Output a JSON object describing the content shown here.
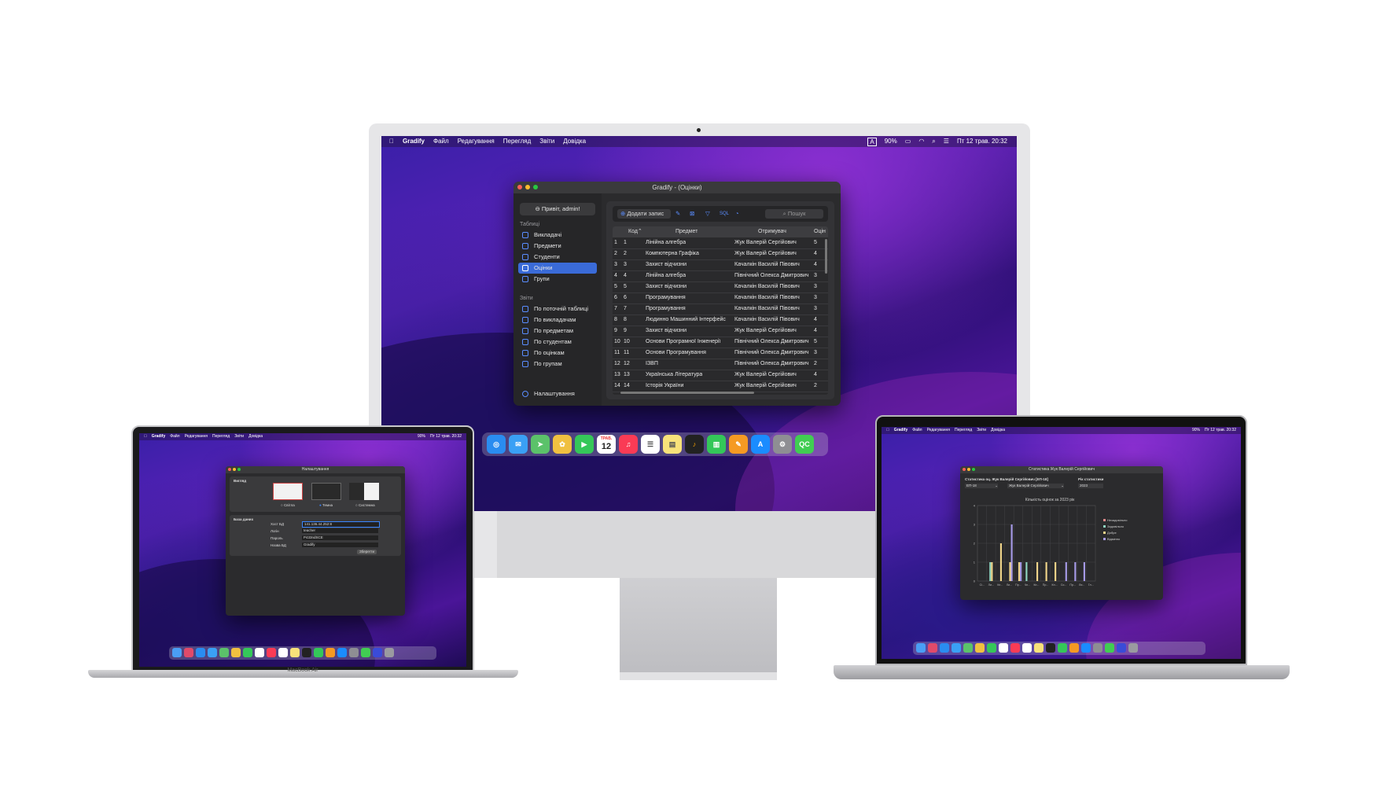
{
  "imac": {
    "menubar": {
      "app": "Gradify",
      "items": [
        "Файл",
        "Редагування",
        "Перегляд",
        "Звіти",
        "Довідка"
      ],
      "battery": "90%",
      "datetime": "Пт 12 трав. 20:32",
      "input": "A"
    },
    "window": {
      "title": "Gradify - (Оцінки)",
      "greeting": "Привіт, admin!",
      "tables_header": "Таблиці",
      "tables": [
        "Викладачі",
        "Предмети",
        "Студенти",
        "Оцінки",
        "Групи"
      ],
      "reports_header": "Звіти",
      "reports": [
        "По поточній таблиці",
        "По викладачам",
        "По предметам",
        "По студентам",
        "По оцінкам",
        "По групам"
      ],
      "settings": "Налаштування",
      "add_button": "Додати запис",
      "search_placeholder": "Пошук",
      "sql_label": "SQL",
      "columns": [
        "Код",
        "Предмет",
        "Отримувач",
        "Оцін"
      ],
      "rows": [
        {
          "n": "1",
          "id": "1",
          "subject": "Лінійна алгебра",
          "student": "Жук Валерій Сергійович",
          "grade": "5"
        },
        {
          "n": "2",
          "id": "2",
          "subject": "Компютерна Графіка",
          "student": "Жук Валерій Сергійович",
          "grade": "4"
        },
        {
          "n": "3",
          "id": "3",
          "subject": "Захист відчизни",
          "student": "Качалкін Василій Півович",
          "grade": "4"
        },
        {
          "n": "4",
          "id": "4",
          "subject": "Лінійна алгебра",
          "student": "Північний Олекса Дмитрович",
          "grade": "3"
        },
        {
          "n": "5",
          "id": "5",
          "subject": "Захист відчизни",
          "student": "Качалкін Василій Півович",
          "grade": "3"
        },
        {
          "n": "6",
          "id": "6",
          "subject": "Програмування",
          "student": "Качалкін Василій Півович",
          "grade": "3"
        },
        {
          "n": "7",
          "id": "7",
          "subject": "Програмування",
          "student": "Качалкін Василій Півович",
          "grade": "3"
        },
        {
          "n": "8",
          "id": "8",
          "subject": "Людинно Машинний Інтерфейс",
          "student": "Качалкін Василій Півович",
          "grade": "4"
        },
        {
          "n": "9",
          "id": "9",
          "subject": "Захист відчизни",
          "student": "Жук Валерій Сергійович",
          "grade": "4"
        },
        {
          "n": "10",
          "id": "10",
          "subject": "Основи Програмної Інженерії",
          "student": "Північний Олекса Дмитрович",
          "grade": "5"
        },
        {
          "n": "11",
          "id": "11",
          "subject": "Основи Програмування",
          "student": "Північний Олекса Дмитрович",
          "grade": "3"
        },
        {
          "n": "12",
          "id": "12",
          "subject": "ІЗВП",
          "student": "Північний Олекса Дмитрович",
          "grade": "2"
        },
        {
          "n": "13",
          "id": "13",
          "subject": "Українська Література",
          "student": "Жук Валерій Сергійович",
          "grade": "4"
        },
        {
          "n": "14",
          "id": "14",
          "subject": "Історія України",
          "student": "Жук Валерій Сергійович",
          "grade": "2"
        }
      ]
    },
    "dock": {
      "calendar_month": "ТРАВ.",
      "calendar_day": "12",
      "last": "QC"
    }
  },
  "macbook_air": {
    "label": "MacBook Air",
    "menubar": {
      "app": "Gradify",
      "items": [
        "Файл",
        "Редагування",
        "Перегляд",
        "Звіти",
        "Довідка"
      ],
      "battery": "90%",
      "datetime": "Пт 12 трав. 20:32"
    },
    "window": {
      "title": "Налаштування",
      "appearance_header": "Вигляд",
      "themes": [
        "Світла",
        "Темна",
        "Системна"
      ],
      "db_header": "База даних",
      "fields": [
        {
          "label": "Хост БД",
          "value": "141.136.44.252:8"
        },
        {
          "label": "Логін",
          "value": "teacher"
        },
        {
          "label": "Пароль",
          "value": "P433ndSCE"
        },
        {
          "label": "Назва БД",
          "value": "Gradify"
        }
      ],
      "save": "Зберегти"
    }
  },
  "macbook_pro": {
    "menubar": {
      "app": "Gradify",
      "items": [
        "Файл",
        "Редагування",
        "Перегляд",
        "Звіти",
        "Довідка"
      ],
      "battery": "90%",
      "datetime": "Пт 12 трав. 20:32"
    },
    "window": {
      "title": "Статистика Жук Валерій Сергійович",
      "stat_label": "Статистика оц. Жук Валерій Сергійович [ЕП-18]",
      "year_label": "Рік статистики",
      "group_value": "ЕП-18",
      "student_value": "Жук Валерій Сергійович",
      "year_value": "2023"
    },
    "chart_data": {
      "type": "bar",
      "title": "Кількість оцінок за 2023 рік",
      "categories": [
        "Сі...",
        "Ли...",
        "Кп...",
        "Ли...",
        "Пр...",
        "Чп...",
        "Кп...",
        "Пр...",
        "Кп...",
        "Со...",
        "Пр...",
        "Ли...",
        "Гл..."
      ],
      "series": [
        {
          "name": "Незадовільно",
          "color": "#e08a8a",
          "values": [
            0,
            0,
            0,
            0,
            0,
            0,
            0,
            0,
            0,
            0,
            0,
            0,
            0
          ]
        },
        {
          "name": "Задовільно",
          "color": "#8fd6c0",
          "values": [
            0,
            1,
            0,
            0,
            0,
            1,
            0,
            0,
            0,
            0,
            0,
            0,
            0
          ]
        },
        {
          "name": "Добре",
          "color": "#f0d58a",
          "values": [
            0,
            1,
            2,
            1,
            1,
            0,
            1,
            1,
            1,
            0,
            0,
            0,
            0
          ]
        },
        {
          "name": "Відмінно",
          "color": "#a79be8",
          "values": [
            0,
            0,
            0,
            3,
            1,
            0,
            0,
            0,
            0,
            1,
            1,
            1,
            0
          ]
        }
      ],
      "ylim": [
        0,
        4
      ],
      "yticks": [
        "0",
        "1",
        "2",
        "3",
        "4"
      ],
      "legend": "right"
    }
  }
}
